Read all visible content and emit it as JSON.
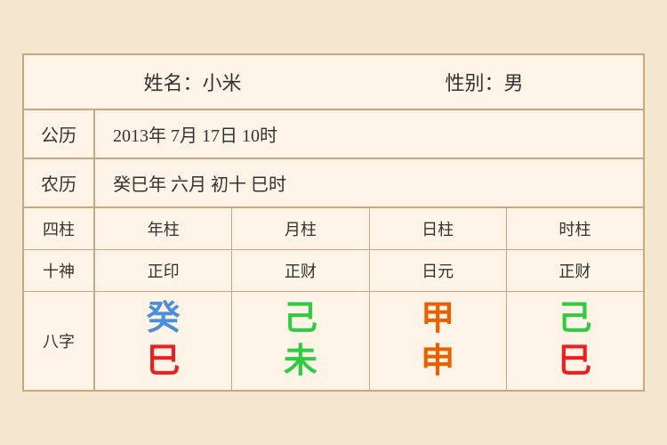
{
  "header": {
    "name_label": "姓名：小米",
    "gender_label": "性别：男"
  },
  "gregorian": {
    "label": "公历",
    "value": "2013年 7月 17日 10时"
  },
  "lunar": {
    "label": "农历",
    "value": "癸巳年 六月 初十 巳时"
  },
  "columns": {
    "header_label": "四柱",
    "cols": [
      "年柱",
      "月柱",
      "日柱",
      "时柱"
    ]
  },
  "shishen": {
    "label": "十神",
    "values": [
      "正印",
      "正财",
      "日元",
      "正财"
    ]
  },
  "bazi": {
    "label": "八字",
    "chars": [
      {
        "top": "癸",
        "top_color": "blue",
        "bottom": "巳",
        "bottom_color": "red"
      },
      {
        "top": "己",
        "top_color": "green",
        "bottom": "未",
        "bottom_color": "green"
      },
      {
        "top": "甲",
        "top_color": "orange",
        "bottom": "申",
        "bottom_color": "orange"
      },
      {
        "top": "己",
        "top_color": "green",
        "bottom": "巳",
        "bottom_color": "red"
      }
    ]
  }
}
